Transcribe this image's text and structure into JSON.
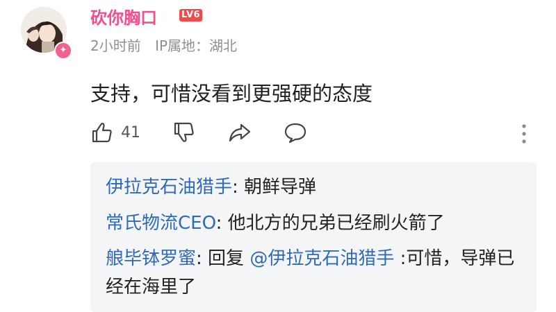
{
  "user": {
    "name": "砍你胸口",
    "level": "LV6",
    "time_ago": "2小时前",
    "ip_location": "IP属地：湖北"
  },
  "comment": {
    "text": "支持，可惜没看到更强硬的态度"
  },
  "actions": {
    "like_count": "41"
  },
  "replies": [
    {
      "name": "伊拉克石油猎手",
      "sep": ": ",
      "text": "朝鲜导弹"
    },
    {
      "name": "常氏物流CEO",
      "sep": ": ",
      "text": "他北方的兄弟已经刷火箭了"
    },
    {
      "name": "艆毕钵罗蜜",
      "sep": ": ",
      "pre": "回复 ",
      "mention": "@伊拉克石油猎手",
      "text": " :可惜，导弹已经在海里了"
    }
  ],
  "colors": {
    "username": "#f0508c",
    "level_badge": "#ef4b4b",
    "reply_name": "#2f6ab8",
    "meta": "#8f8f8f",
    "reply_bg": "#f4f5f7"
  },
  "icons": [
    "thumbs-up-icon",
    "thumbs-down-icon",
    "share-icon",
    "comment-icon",
    "more-vertical-icon",
    "star-badge-icon"
  ]
}
